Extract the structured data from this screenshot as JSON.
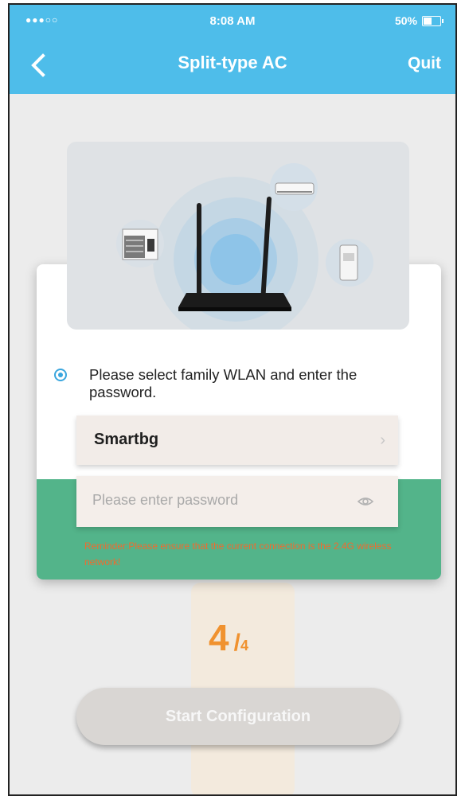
{
  "status_bar": {
    "signal": "●●●○○",
    "time": "8:08 AM",
    "battery": "50%"
  },
  "header": {
    "title": "Split-type AC",
    "quit_label": "Quit"
  },
  "instruction": {
    "text": "Please select family WLAN and enter the password."
  },
  "wifi": {
    "selected_network": "Smartbg",
    "chevron": "›"
  },
  "password": {
    "placeholder": "Please enter password",
    "value": ""
  },
  "reminder": {
    "text": "Reminder:Please ensure that the current connection is the 2.4G wireless network!"
  },
  "step": {
    "current": "4",
    "separator": "/",
    "total": "4"
  },
  "actions": {
    "start_label": "Start Configuration"
  },
  "colors": {
    "header": "#4ebdea",
    "accent_green": "#53b48a",
    "step_orange": "#f0922f",
    "reminder_orange": "#ef6b2f",
    "radio_blue": "#3aa6de"
  }
}
